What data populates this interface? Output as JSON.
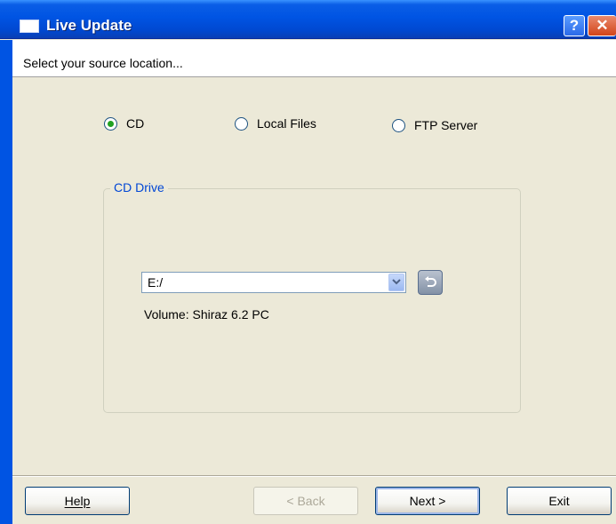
{
  "window": {
    "title": "Live Update",
    "help_glyph": "?",
    "close_glyph": "✕"
  },
  "header": {
    "instruction": "Select your source location..."
  },
  "source_options": [
    {
      "label": "CD",
      "selected": true
    },
    {
      "label": "Local Files",
      "selected": false
    },
    {
      "label": "FTP Server",
      "selected": false
    }
  ],
  "cd_drive_group": {
    "title": "CD Drive",
    "drive_value": "E:/",
    "volume_text": "Volume: Shiraz 6.2 PC"
  },
  "buttons": {
    "help": "Help",
    "back": "< Back",
    "next": "Next >",
    "exit": "Exit"
  },
  "icons": {
    "app": "window-icon",
    "combo_arrow": "chevron-down-icon",
    "refresh": "refresh-icon"
  },
  "colors": {
    "title_bar": "#0054e3",
    "group_title": "#0046d5",
    "radio_dot": "#21a121"
  }
}
